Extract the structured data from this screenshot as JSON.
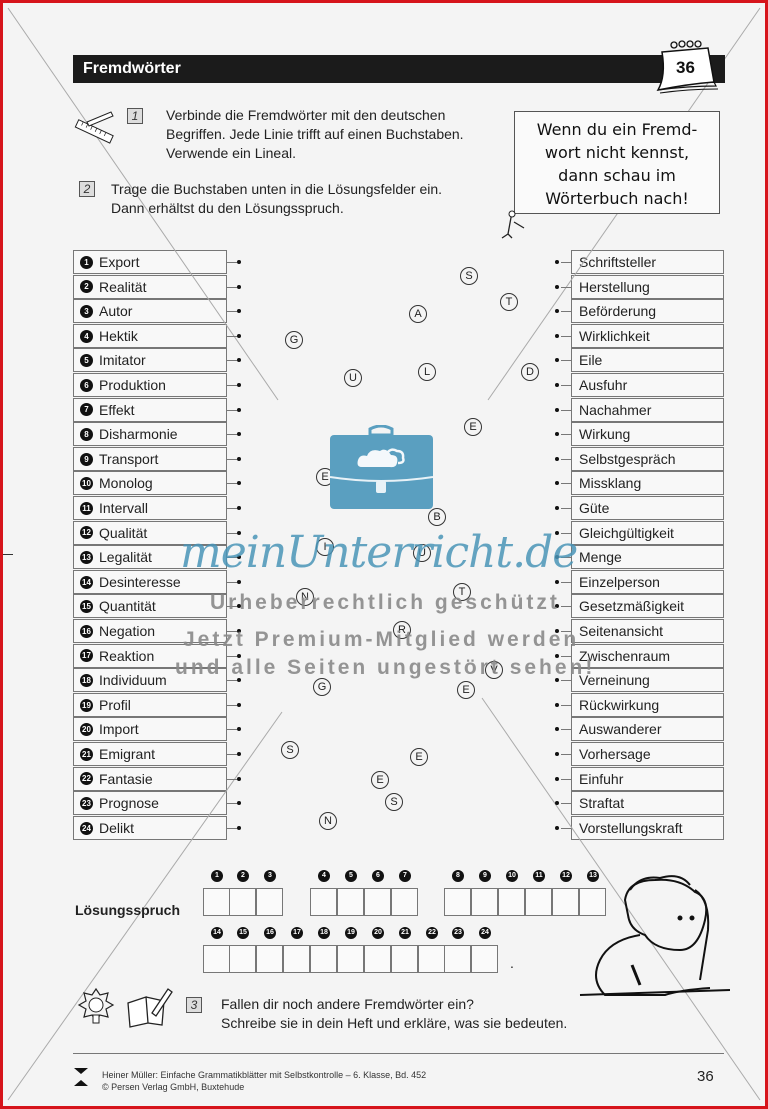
{
  "header": {
    "title": "Fremdwörter",
    "page_badge": "36"
  },
  "tasks": [
    {
      "number": "1",
      "lines": [
        "Verbinde die Fremdwörter mit den deutschen",
        "Begriffen. Jede Linie trifft auf einen Buchstaben.",
        "Verwende ein Lineal."
      ]
    },
    {
      "number": "2",
      "lines": [
        "Trage die Buchstaben unten in die Lösungsfelder ein.",
        "Dann erhältst du den Lösungsspruch."
      ]
    },
    {
      "number": "3",
      "lines": [
        "Fallen dir noch andere Fremdwörter ein?",
        "Schreibe sie in dein Heft und erkläre, was sie bedeuten."
      ]
    }
  ],
  "note": {
    "lines": [
      "Wenn du ein Fremd-",
      "wort nicht kennst,",
      "dann schau im",
      "Wörterbuch nach!"
    ]
  },
  "foreign_words": [
    {
      "n": "1",
      "word": "Export"
    },
    {
      "n": "2",
      "word": "Realität"
    },
    {
      "n": "3",
      "word": "Autor"
    },
    {
      "n": "4",
      "word": "Hektik"
    },
    {
      "n": "5",
      "word": "Imitator"
    },
    {
      "n": "6",
      "word": "Produktion"
    },
    {
      "n": "7",
      "word": "Effekt"
    },
    {
      "n": "8",
      "word": "Disharmonie"
    },
    {
      "n": "9",
      "word": "Transport"
    },
    {
      "n": "10",
      "word": "Monolog"
    },
    {
      "n": "11",
      "word": "Intervall"
    },
    {
      "n": "12",
      "word": "Qualität"
    },
    {
      "n": "13",
      "word": "Legalität"
    },
    {
      "n": "14",
      "word": "Desinteresse"
    },
    {
      "n": "15",
      "word": "Quantität"
    },
    {
      "n": "16",
      "word": "Negation"
    },
    {
      "n": "17",
      "word": "Reaktion"
    },
    {
      "n": "18",
      "word": "Individuum"
    },
    {
      "n": "19",
      "word": "Profil"
    },
    {
      "n": "20",
      "word": "Import"
    },
    {
      "n": "21",
      "word": "Emigrant"
    },
    {
      "n": "22",
      "word": "Fantasie"
    },
    {
      "n": "23",
      "word": "Prognose"
    },
    {
      "n": "24",
      "word": "Delikt"
    }
  ],
  "german_words": [
    "Schriftsteller",
    "Herstellung",
    "Beförderung",
    "Wirklichkeit",
    "Eile",
    "Ausfuhr",
    "Nachahmer",
    "Wirkung",
    "Selbstgespräch",
    "Missklang",
    "Güte",
    "Gleichgültigkeit",
    "Menge",
    "Einzelperson",
    "Gesetzmäßigkeit",
    "Seitenansicht",
    "Zwischenraum",
    "Verneinung",
    "Rückwirkung",
    "Auswanderer",
    "Vorhersage",
    "Einfuhr",
    "Straftat",
    "Vorstellungskraft"
  ],
  "letters": [
    "S",
    "T",
    "A",
    "G",
    "U",
    "L",
    "D",
    "E",
    "R",
    "E",
    "B",
    "I",
    "U",
    "N",
    "T",
    "R",
    "V",
    "G",
    "E",
    "S",
    "E",
    "E",
    "S",
    "N"
  ],
  "solution": {
    "label": "Lösungsspruch",
    "row1_numbers": [
      "1",
      "2",
      "3",
      "4",
      "5",
      "6",
      "7",
      "8",
      "9",
      "10",
      "11",
      "12",
      "13"
    ],
    "row2_numbers": [
      "14",
      "15",
      "16",
      "17",
      "18",
      "19",
      "20",
      "21",
      "22",
      "23",
      "24"
    ],
    "end_mark": "."
  },
  "watermark": {
    "brand": "meinUnterricht.de",
    "line1": "Urheberrechtlich geschützt",
    "line2": "Jetzt Premium-Mitglied werden",
    "line3": "und alle Seiten ungestört sehen!"
  },
  "footer": {
    "line1": "Heiner Müller: Einfache Grammatikblätter mit Selbstkontrolle – 6. Klasse, Bd. 452",
    "line2": "© Persen Verlag GmbH, Buxtehude",
    "page_number": "36",
    "publisher_logo_text": "Persen"
  },
  "colors": {
    "frame": "#d6141b",
    "title_bar": "#1b1b1b",
    "watermark_blue": "#4a95b8"
  }
}
